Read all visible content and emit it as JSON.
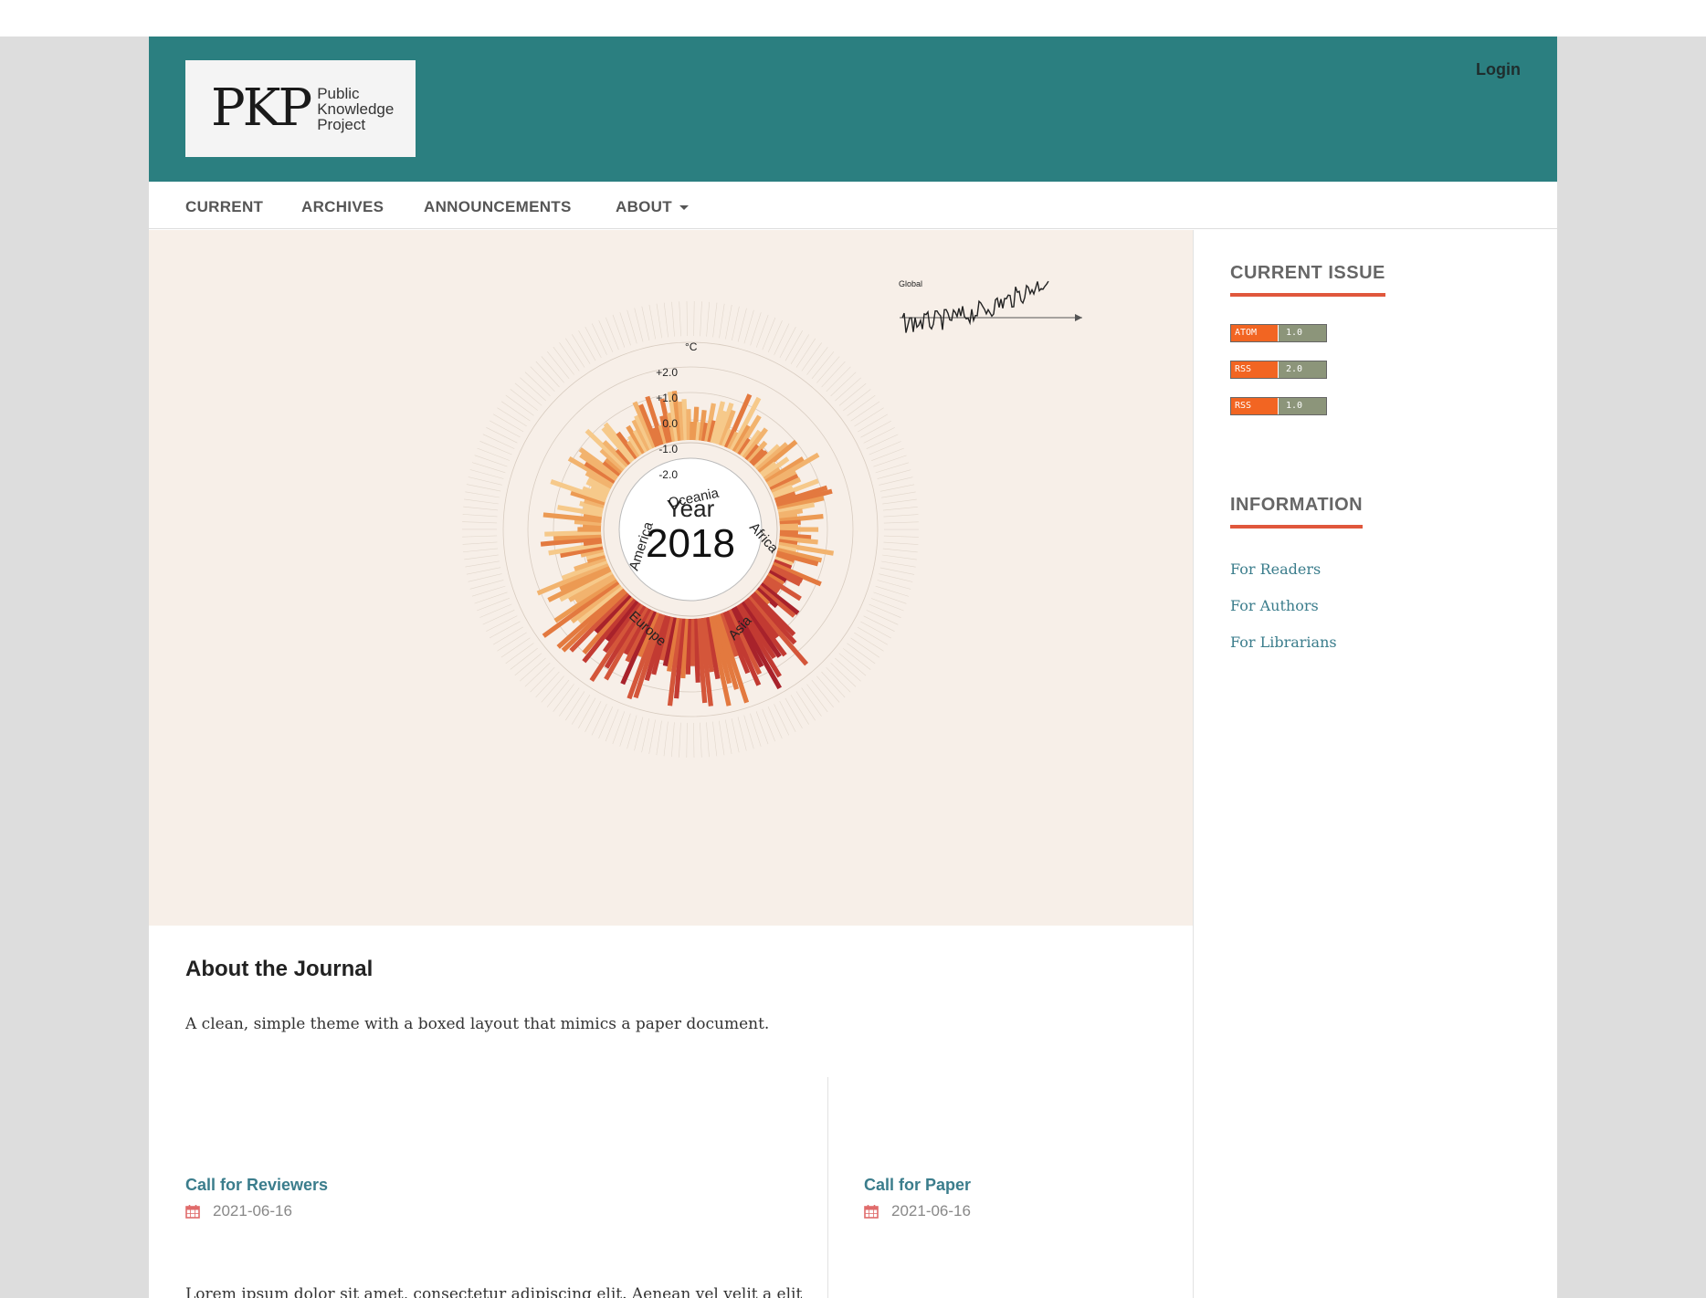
{
  "header": {
    "logo": {
      "mark": "PKP",
      "lines": [
        "Public",
        "Knowledge",
        "Project"
      ]
    },
    "login_label": "Login",
    "color": "#2b7f80"
  },
  "nav": {
    "items": [
      "CURRENT",
      "ARCHIVES",
      "ANNOUNCEMENTS",
      "ABOUT"
    ]
  },
  "hero": {
    "center_label": "Year",
    "center_year": "2018",
    "unit": "°C",
    "scale_labels": [
      "+2.0",
      "+1.0",
      "0.0",
      "-1.0",
      "-2.0"
    ],
    "continents": [
      "Oceania",
      "Africa",
      "Asia",
      "Europe",
      "America"
    ],
    "inset_label": "Global"
  },
  "sidebar": {
    "current_issue_heading": "CURRENT ISSUE",
    "feeds": [
      {
        "key": "ATOM",
        "version": "1.0"
      },
      {
        "key": "RSS",
        "version": "2.0"
      },
      {
        "key": "RSS",
        "version": "1.0"
      }
    ],
    "information_heading": "INFORMATION",
    "links": [
      "For Readers",
      "For Authors",
      "For Librarians"
    ],
    "accent": "#e0573c"
  },
  "main": {
    "about_title": "About the Journal",
    "about_description": "A clean, simple theme with a boxed layout that mimics a paper document.",
    "announcements": [
      {
        "title": "Call for Reviewers",
        "date": "2021-06-16"
      },
      {
        "title": "Call for Paper",
        "date": "2021-06-16"
      }
    ],
    "announcement_body": "Lorem ipsum dolor sit amet, consectetur adipiscing elit. Aenean vel velit a elit porta consequat. Duis faucibus odio ac vehicula placerat. Quisque vehicula"
  }
}
